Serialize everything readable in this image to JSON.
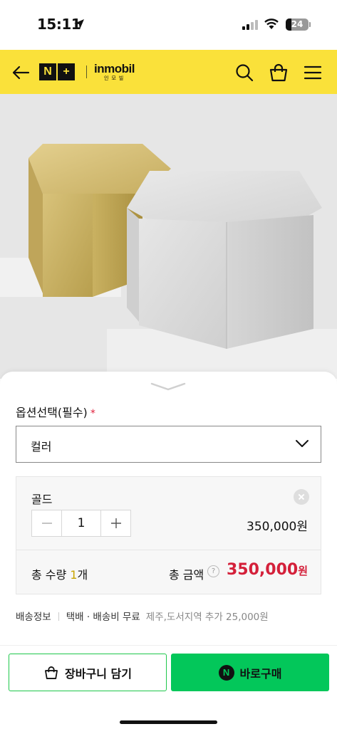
{
  "status_bar": {
    "time": "15:11",
    "battery": "24"
  },
  "header": {
    "logo_badge": [
      "N",
      "+"
    ],
    "brand_name": "inmobil",
    "brand_sub": "인모빌",
    "accent_color": "#fae13a",
    "icons": [
      "back-arrow-icon",
      "search-icon",
      "shopping-bag-icon",
      "menu-icon"
    ]
  },
  "options": {
    "title": "옵션선택(필수)",
    "required_mark": "*",
    "select_value": "컬러"
  },
  "selected_item": {
    "name": "골드",
    "quantity": "1",
    "price": "350,000원"
  },
  "totals": {
    "qty_label": "총 수량 ",
    "qty_value": "1",
    "qty_unit": "개",
    "amount_label": "총 금액",
    "help": "?",
    "amount_value": "350,000",
    "amount_unit": "원"
  },
  "shipping": {
    "label": "배송정보",
    "method": "택배 · 배송비 무료",
    "extra": "제주,도서지역 추가 25,000원"
  },
  "actions": {
    "cart_label": "장바구니 담기",
    "buy_badge": "N",
    "buy_label": "바로구매"
  },
  "colors": {
    "price_red": "#d4203a",
    "naver_green": "#03c75a"
  }
}
